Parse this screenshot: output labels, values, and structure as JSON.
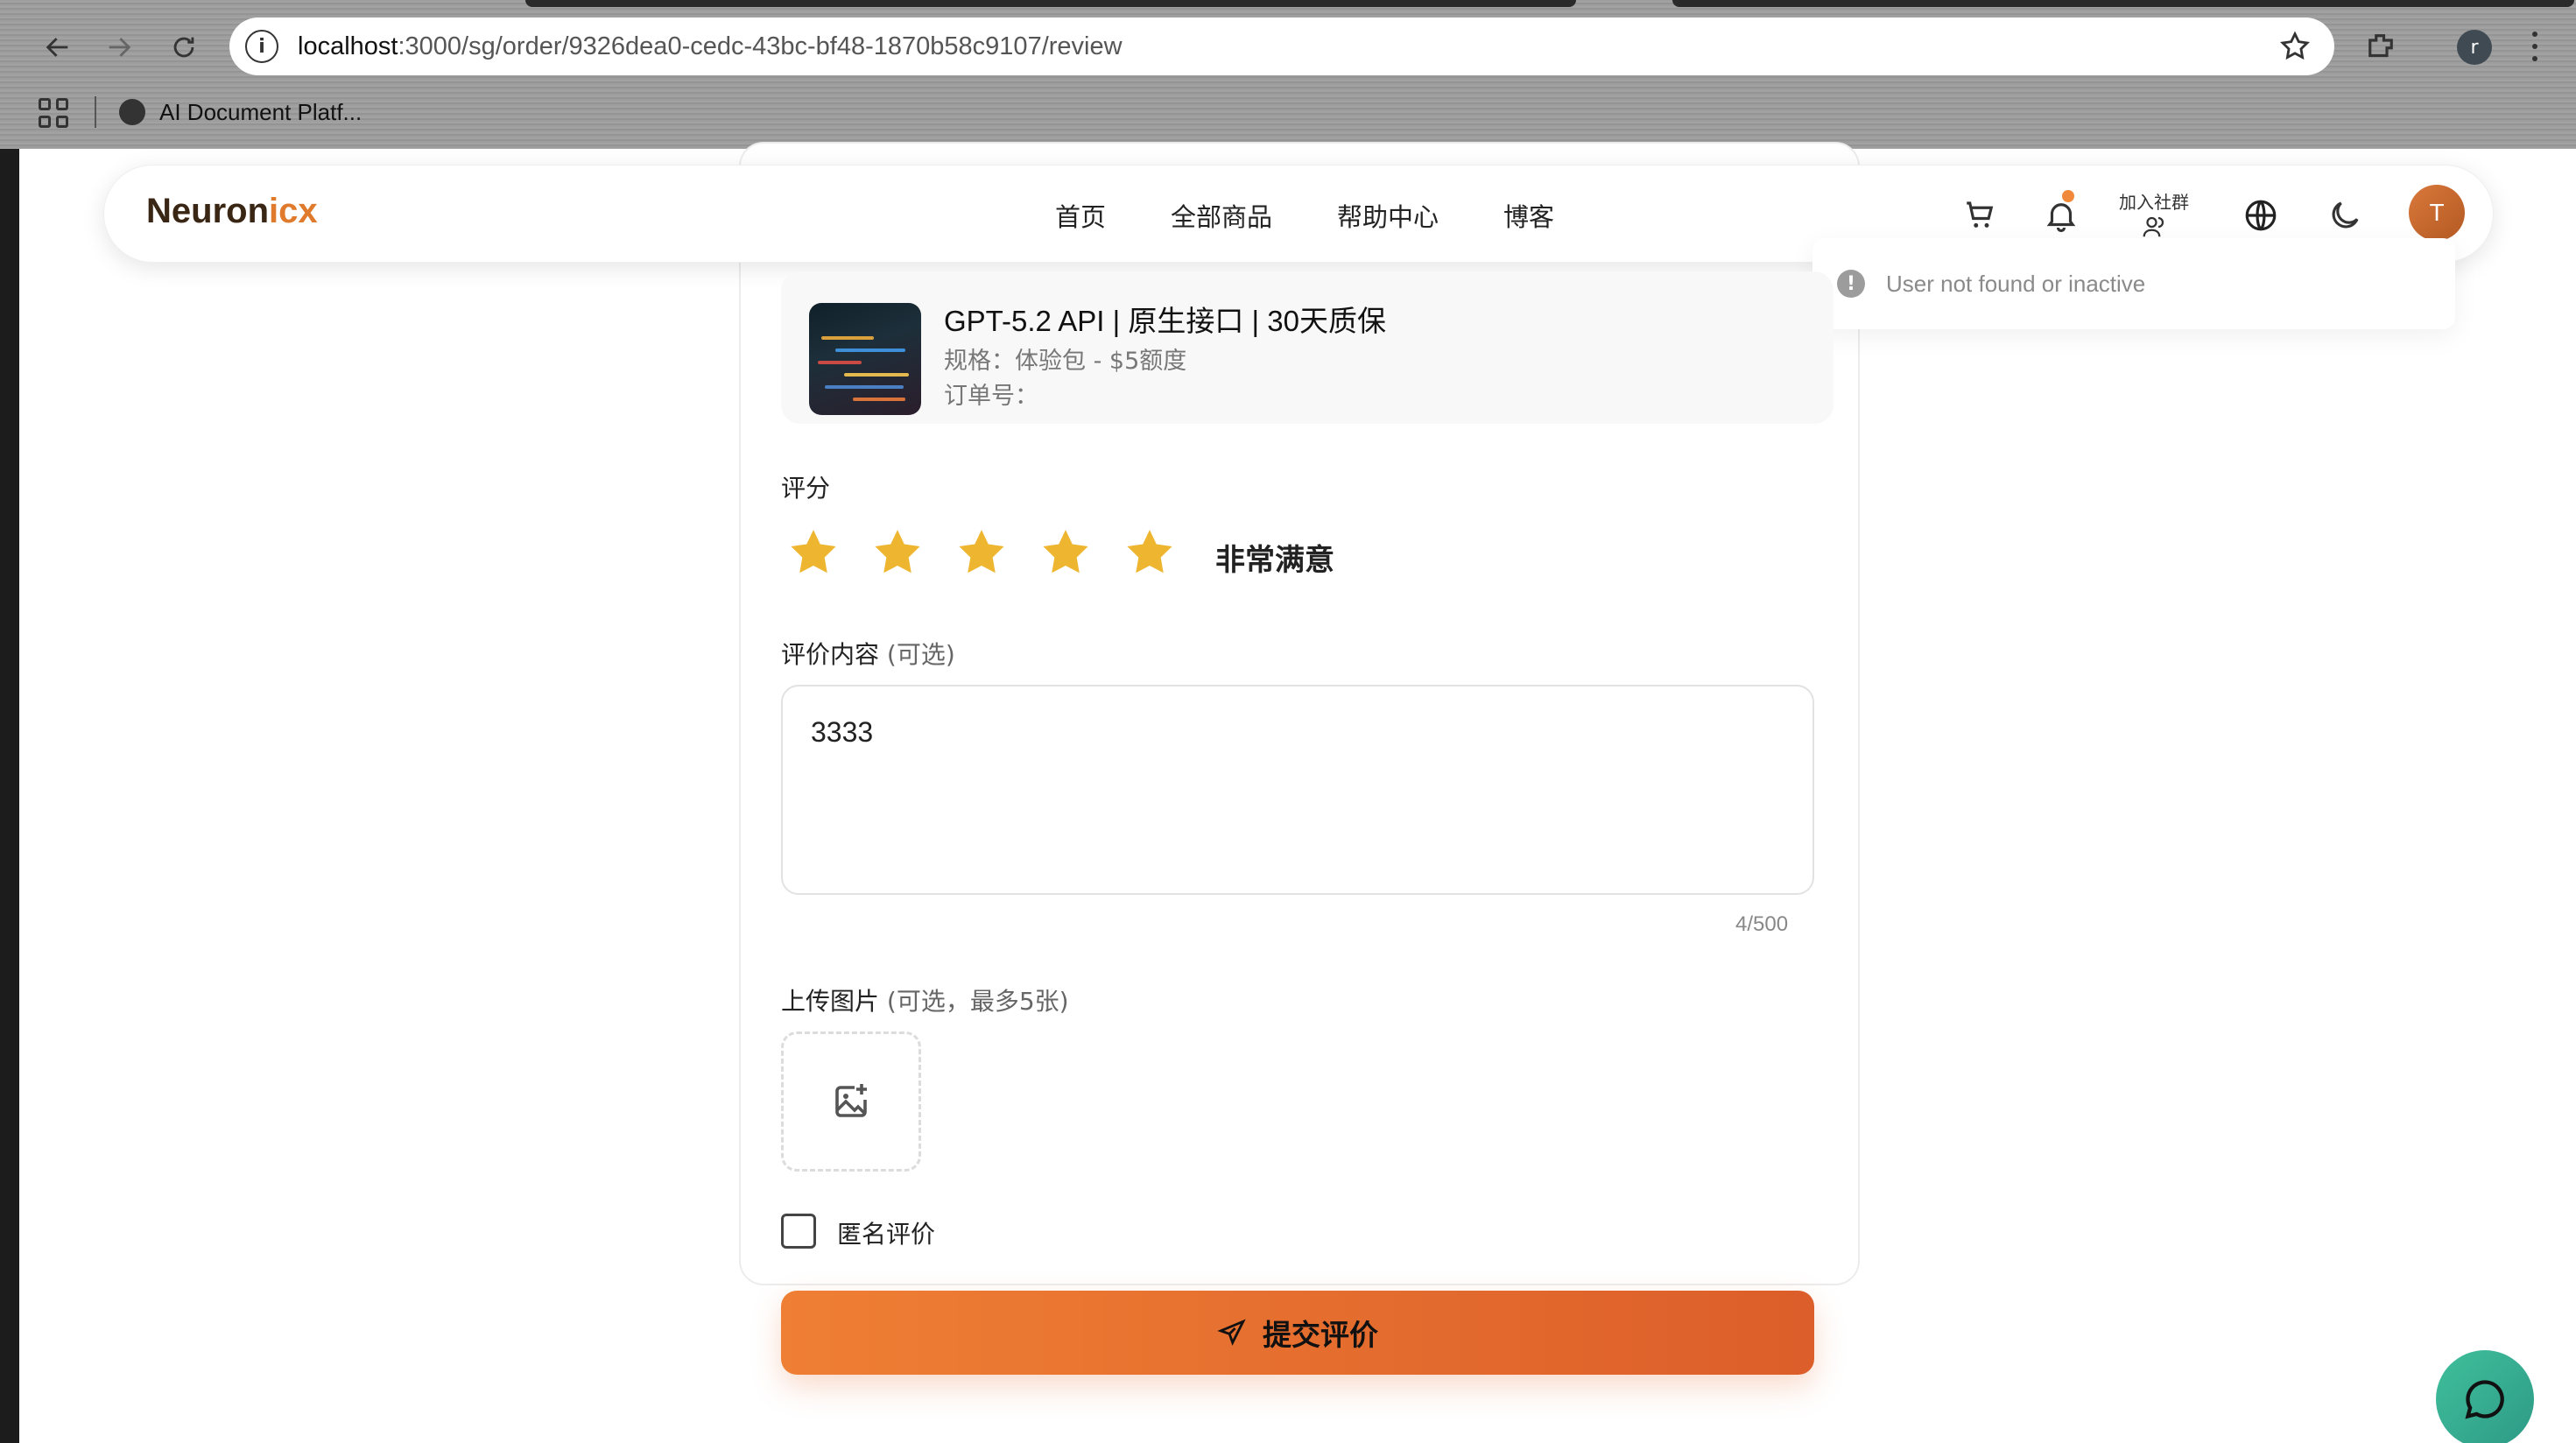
{
  "browser": {
    "url_host": "localhost",
    "url_path": ":3000/sg/order/9326dea0-cedc-43bc-bf48-1870b58c9107/review",
    "bookmark_label": "AI Document Platf...",
    "profile_initial": "r"
  },
  "header": {
    "logo_a": "Neuron",
    "logo_b": "icx",
    "nav": [
      "首页",
      "全部商品",
      "帮助中心",
      "博客"
    ],
    "join_label": "加入社群",
    "avatar_initial": "T"
  },
  "toast": {
    "message": "User not found or inactive"
  },
  "product": {
    "title": "GPT-5.2 API | 原生接口 | 30天质保",
    "spec": "规格：体验包 - $5额度",
    "order_no": "订单号："
  },
  "rating": {
    "label": "评分",
    "stars": 5,
    "max": 5,
    "text": "非常满意"
  },
  "review": {
    "label": "评价内容",
    "hint": "(可选)",
    "value": "3333",
    "counter": "4/500"
  },
  "upload": {
    "label": "上传图片",
    "hint": "(可选，最多5张)"
  },
  "anonymous": {
    "label": "匿名评价",
    "checked": false
  },
  "submit": {
    "label": "提交评价"
  },
  "colors": {
    "accent": "#e8712e",
    "star": "#f0b429",
    "chat": "#3ab394"
  }
}
